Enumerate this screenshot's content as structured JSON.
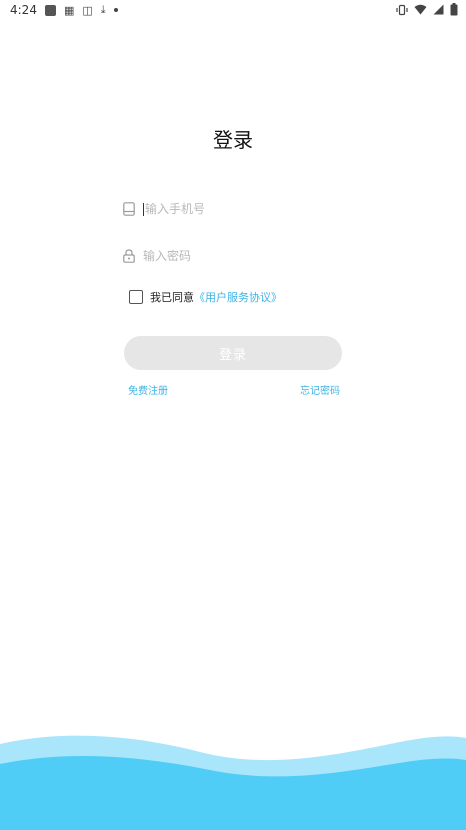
{
  "status_bar": {
    "time": "4:24",
    "left_icons": [
      "notification-square-icon",
      "a-icon",
      "clipboard-icon",
      "download-icon",
      "dot-icon"
    ],
    "right_icons": [
      "vibrate-icon",
      "wifi-icon",
      "signal-icon",
      "battery-icon"
    ]
  },
  "page": {
    "title": "登录"
  },
  "form": {
    "phone_placeholder": "输入手机号",
    "password_placeholder": "输入密码",
    "agree_prefix": "我已同意",
    "agree_link": "《用户服务协议》",
    "login_button": "登录",
    "register_link": "免费注册",
    "forgot_link": "忘记密码"
  },
  "colors": {
    "accent": "#3bb4e6",
    "button_disabled": "#e6e6e6",
    "wave_light": "#a9e6fb",
    "wave_dark": "#4fcdf7"
  }
}
